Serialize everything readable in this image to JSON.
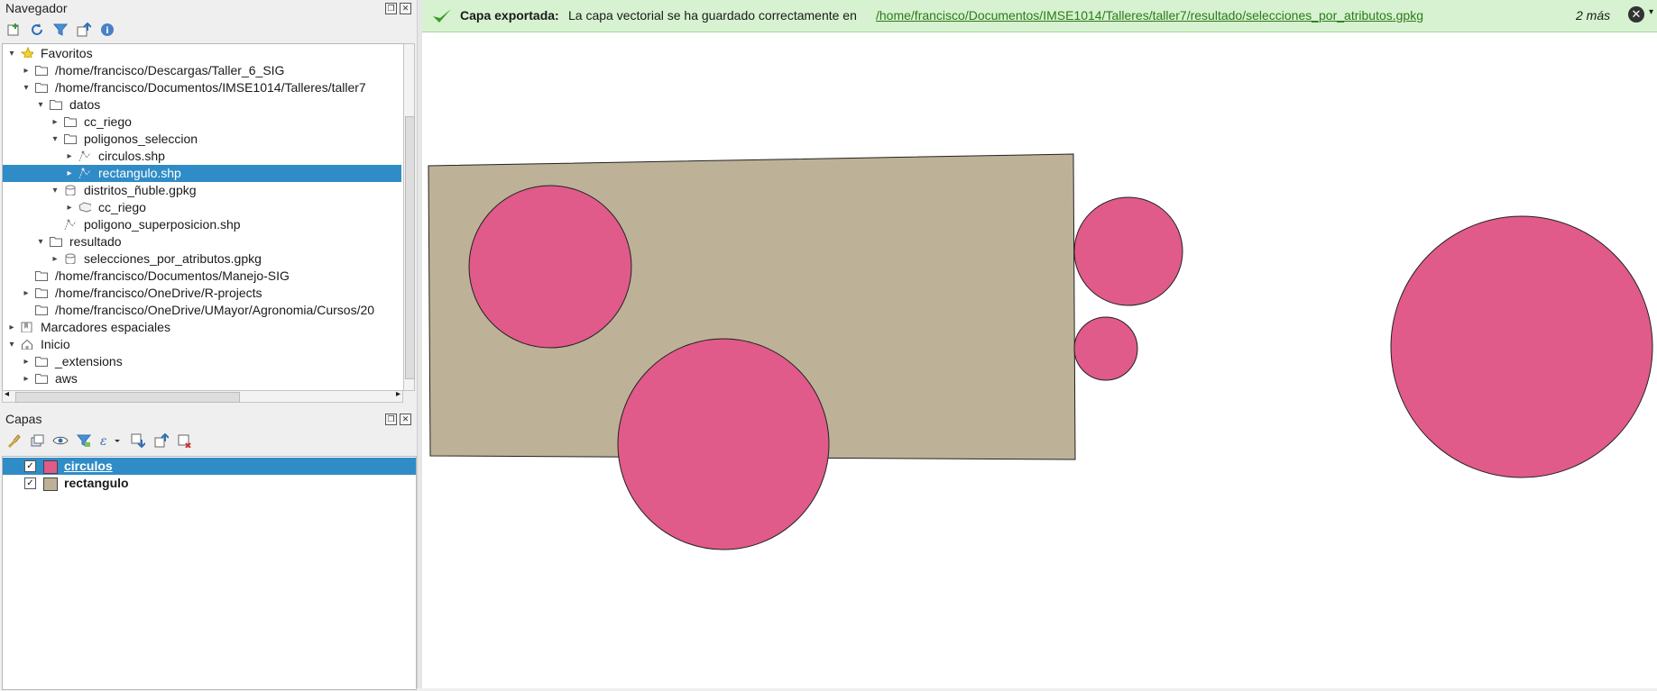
{
  "browser": {
    "title": "Navegador",
    "tree": [
      {
        "label": "Favoritos",
        "icon": "star-icon",
        "arrow": "down",
        "indent": 0
      },
      {
        "label": "/home/francisco/Descargas/Taller_6_SIG",
        "icon": "folder-icon",
        "arrow": "right",
        "indent": 1
      },
      {
        "label": "/home/francisco/Documentos/IMSE1014/Talleres/taller7",
        "icon": "folder-icon",
        "arrow": "down",
        "indent": 1
      },
      {
        "label": "datos",
        "icon": "folder-icon",
        "arrow": "down",
        "indent": 2
      },
      {
        "label": "cc_riego",
        "icon": "folder-icon",
        "arrow": "right",
        "indent": 3
      },
      {
        "label": "poligonos_seleccion",
        "icon": "folder-icon",
        "arrow": "down",
        "indent": 3
      },
      {
        "label": "circulos.shp",
        "icon": "vector-layer-icon",
        "arrow": "right",
        "indent": 4
      },
      {
        "label": "rectangulo.shp",
        "icon": "vector-layer-icon",
        "arrow": "right",
        "indent": 4,
        "selected": true
      },
      {
        "label": "distritos_ñuble.gpkg",
        "icon": "database-icon",
        "arrow": "down",
        "indent": 3
      },
      {
        "label": "cc_riego",
        "icon": "polygon-layer-icon",
        "arrow": "right",
        "indent": 4
      },
      {
        "label": "poligono_superposicion.shp",
        "icon": "vector-layer-icon",
        "arrow": "none",
        "indent": 3
      },
      {
        "label": "resultado",
        "icon": "folder-icon",
        "arrow": "down",
        "indent": 2
      },
      {
        "label": "selecciones_por_atributos.gpkg",
        "icon": "database-icon",
        "arrow": "right",
        "indent": 3
      },
      {
        "label": "/home/francisco/Documentos/Manejo-SIG",
        "icon": "folder-icon",
        "arrow": "none",
        "indent": 1
      },
      {
        "label": "/home/francisco/OneDrive/R-projects",
        "icon": "folder-icon",
        "arrow": "right",
        "indent": 1
      },
      {
        "label": "/home/francisco/OneDrive/UMayor/Agronomia/Cursos/20",
        "icon": "folder-icon",
        "arrow": "none",
        "indent": 1
      },
      {
        "label": "Marcadores espaciales",
        "icon": "bookmark-icon",
        "arrow": "right",
        "indent": 0
      },
      {
        "label": "Inicio",
        "icon": "home-icon",
        "arrow": "down",
        "indent": 0
      },
      {
        "label": "_extensions",
        "icon": "folder-icon",
        "arrow": "right",
        "indent": 1
      },
      {
        "label": "aws",
        "icon": "folder-icon",
        "arrow": "right",
        "indent": 1
      }
    ]
  },
  "layers_panel": {
    "title": "Capas",
    "layers": [
      {
        "name": "circulos",
        "checked": true,
        "color": "#e05a8a",
        "selected": true
      },
      {
        "name": "rectangulo",
        "checked": true,
        "color": "#bdb297",
        "selected": false
      }
    ]
  },
  "message_bar": {
    "title": "Capa exportada:",
    "text": "La capa vectorial se ha guardado correctamente en",
    "link": "/home/francisco/Documentos/IMSE1014/Talleres/taller7/resultado/selecciones_por_atributos.gpkg",
    "more": "2 más"
  },
  "colors": {
    "selection": "#308cc6",
    "circle_fill": "#e05a8a",
    "rectangle_fill": "#bdb297",
    "message_bg": "#d6f2d0"
  }
}
